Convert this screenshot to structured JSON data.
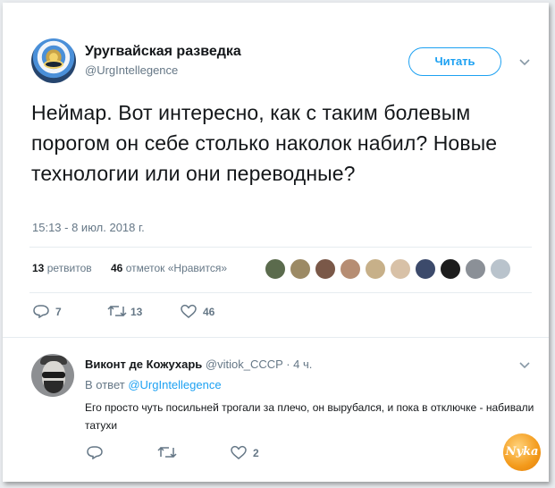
{
  "tweet": {
    "author_name": "Уругвайская разведка",
    "author_handle": "@UrgIntellegence",
    "follow_label": "Читать",
    "text": "Неймар. Вот интересно, как с таким болевым порогом он себе столько наколок набил? Новые технологии или они переводные?",
    "timestamp": "15:13 - 8 июл. 2018 г.",
    "retweets_count": "13",
    "retweets_label": "ретвитов",
    "likes_count": "46",
    "likes_label": "отметок «Нравится»",
    "actions": {
      "replies": "7",
      "retweets": "13",
      "likes": "46"
    }
  },
  "reply": {
    "author_name": "Виконт де Кожухарь",
    "author_handle": "@vitiok_CCCP",
    "separator": " · ",
    "time": "4 ч.",
    "reply_to_label": "В ответ",
    "reply_to_handle": "@UrgIntellegence",
    "text": "Его просто чуть посильней трогали за плечо, он вырубался, и пока в отключке - набивали татухи",
    "actions": {
      "replies": "",
      "retweets": "",
      "likes": "2"
    }
  },
  "watermark": {
    "text": "Nyka"
  },
  "colors": {
    "accent": "#1da1f2",
    "muted": "#657786",
    "text": "#14171a",
    "divider": "#e6ecf0"
  },
  "icons": [
    "chevron-down-icon",
    "reply-icon",
    "retweet-icon",
    "heart-icon"
  ]
}
